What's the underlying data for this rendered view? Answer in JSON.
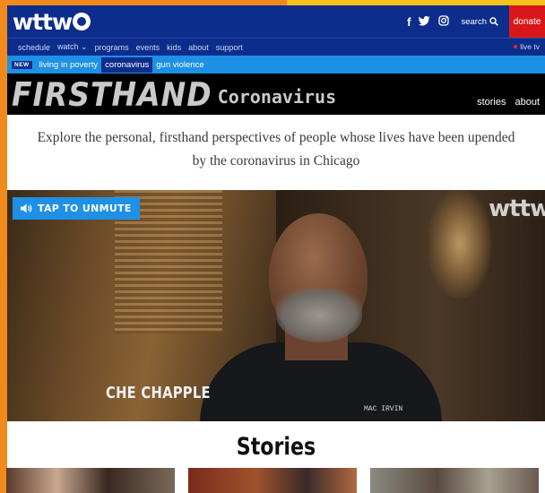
{
  "header": {
    "logo_text": "wttw",
    "social": [
      "f",
      "🐦",
      "◎"
    ],
    "search_label": "search",
    "donate_label": "donate"
  },
  "nav": {
    "items": [
      "schedule",
      "watch ⌄",
      "programs",
      "events",
      "kids",
      "about",
      "support"
    ],
    "live_tv": "live tv"
  },
  "topics": {
    "new_badge": "NEW",
    "items": [
      "living in poverty",
      "coronavirus",
      "gun violence"
    ],
    "active_index": 1
  },
  "firsthand": {
    "title": "FIRSTHAND",
    "subtitle": "Coronavirus",
    "links": [
      "stories",
      "about"
    ]
  },
  "intro": {
    "line1": "Explore the personal, firsthand perspectives of people whose lives have been upended",
    "line2": "by the coronavirus in Chicago"
  },
  "video": {
    "unmute_label": "TAP TO UNMUTE",
    "watermark": "wttw",
    "name_tag": "CHE CHAPPLE",
    "shirt_text": "MAC IRVIN"
  },
  "stories": {
    "heading": "Stories"
  }
}
